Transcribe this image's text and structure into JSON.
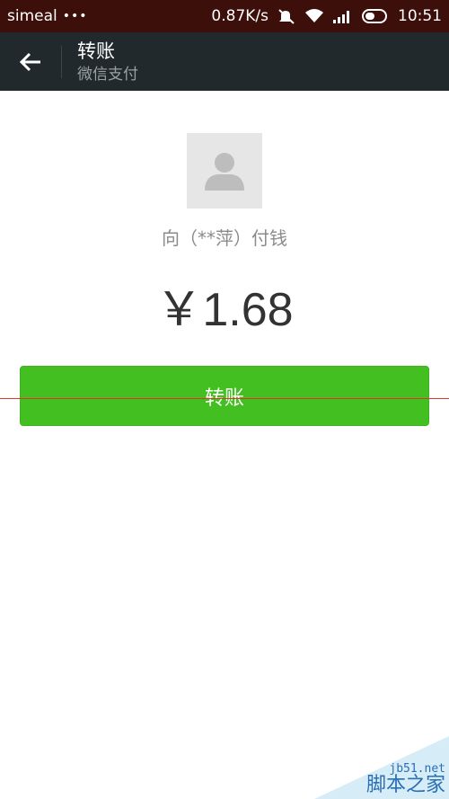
{
  "status_bar": {
    "carrier": "simeal",
    "dots": "•••",
    "speed": "0.87K/s",
    "time": "10:51"
  },
  "header": {
    "title": "转账",
    "subtitle": "微信支付"
  },
  "payee": {
    "label": "向（**萍）付钱"
  },
  "amount": {
    "text": "￥1.68"
  },
  "actions": {
    "transfer_label": "转账"
  },
  "watermark": {
    "url": "jb51.net",
    "name": "脚本之家"
  },
  "colors": {
    "status_bar_bg": "#3d0f0a",
    "title_bar_bg": "#22292c",
    "button_green": "#44bf21",
    "guide_line_red": "#e0362a"
  }
}
